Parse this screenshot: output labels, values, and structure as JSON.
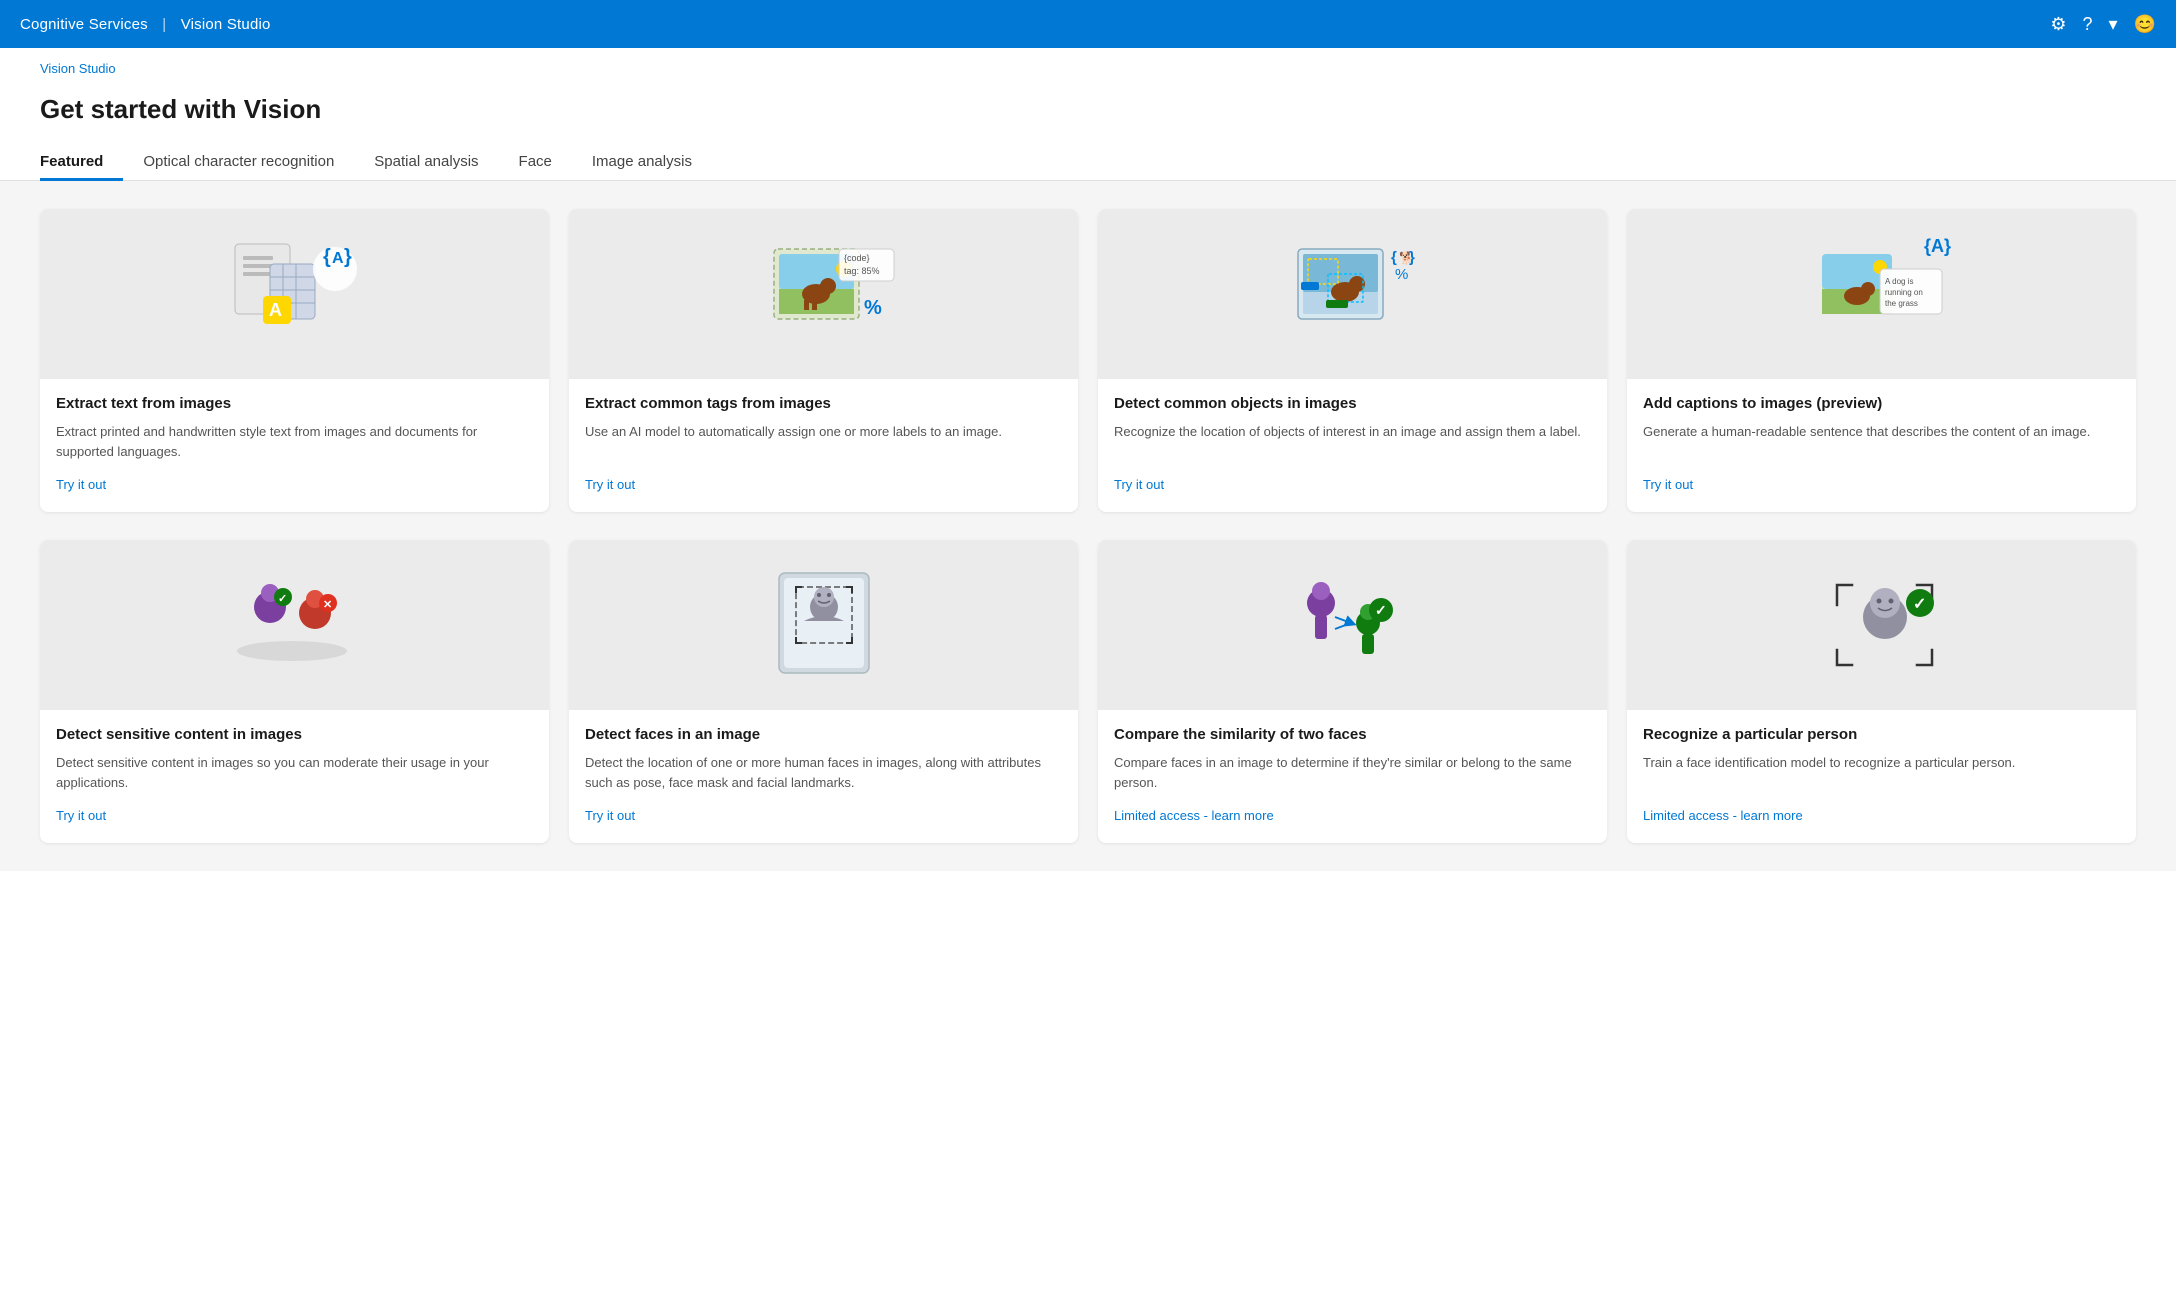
{
  "topnav": {
    "brand": "Cognitive Services",
    "pipe": "|",
    "app": "Vision Studio"
  },
  "breadcrumb": {
    "label": "Vision Studio"
  },
  "page": {
    "title": "Get started with Vision"
  },
  "tabs": [
    {
      "id": "featured",
      "label": "Featured",
      "active": true
    },
    {
      "id": "ocr",
      "label": "Optical character recognition",
      "active": false
    },
    {
      "id": "spatial",
      "label": "Spatial analysis",
      "active": false
    },
    {
      "id": "face",
      "label": "Face",
      "active": false
    },
    {
      "id": "image-analysis",
      "label": "Image analysis",
      "active": false
    }
  ],
  "cards_row1": [
    {
      "id": "extract-text",
      "title": "Extract text from images",
      "desc": "Extract printed and handwritten style text from images and documents for supported languages.",
      "link_label": "Try it out"
    },
    {
      "id": "extract-tags",
      "title": "Extract common tags from images",
      "desc": "Use an AI model to automatically assign one or more labels to an image.",
      "link_label": "Try it out"
    },
    {
      "id": "detect-objects",
      "title": "Detect common objects in images",
      "desc": "Recognize the location of objects of interest in an image and assign them a label.",
      "link_label": "Try it out"
    },
    {
      "id": "add-captions",
      "title": "Add captions to images (preview)",
      "desc": "Generate a human-readable sentence that describes the content of an image.",
      "link_label": "Try it out"
    }
  ],
  "cards_row2": [
    {
      "id": "detect-sensitive",
      "title": "Detect sensitive content in images",
      "desc": "Detect sensitive content in images so you can moderate their usage in your applications.",
      "link_label": "Try it out"
    },
    {
      "id": "detect-faces",
      "title": "Detect faces in an image",
      "desc": "Detect the location of one or more human faces in images, along with attributes such as pose, face mask and facial landmarks.",
      "link_label": "Try it out"
    },
    {
      "id": "compare-faces",
      "title": "Compare the similarity of two faces",
      "desc": "Compare faces in an image to determine if they're similar or belong to the same person.",
      "link_label": "Limited access - learn more"
    },
    {
      "id": "recognize-person",
      "title": "Recognize a particular person",
      "desc": "Train a face identification model to recognize a particular person.",
      "link_label": "Limited access - learn more"
    }
  ]
}
